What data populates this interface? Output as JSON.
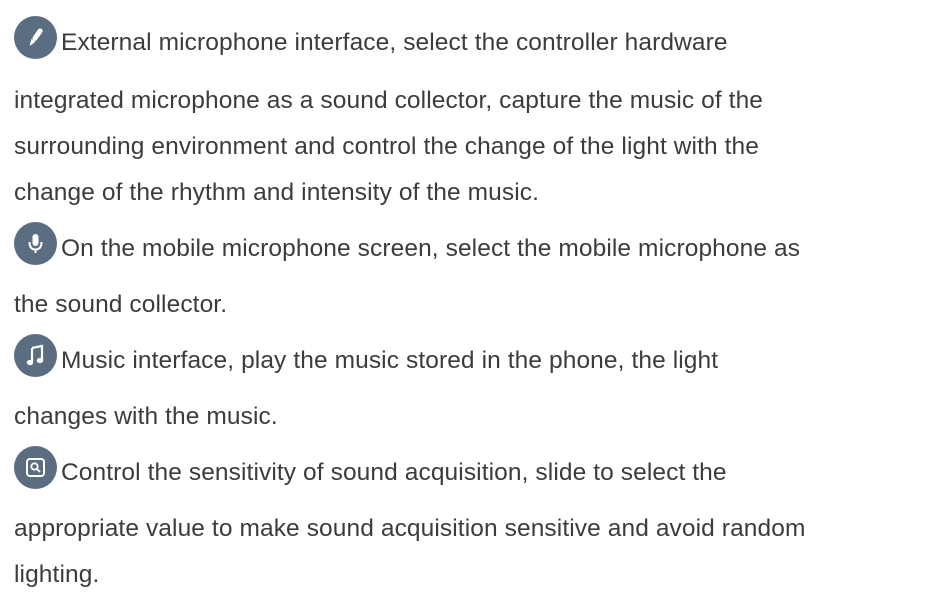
{
  "items": [
    {
      "icon": "microphone-pen-icon",
      "lines": [
        "External microphone interface, select the controller hardware",
        "integrated microphone as a sound collector, capture the music of the",
        "surrounding environment and control the change of the light with the",
        "change of the rhythm and intensity of the music."
      ]
    },
    {
      "icon": "mobile-microphone-icon",
      "lines": [
        "On the mobile microphone screen, select the mobile microphone as",
        "the sound collector."
      ]
    },
    {
      "icon": "music-note-icon",
      "lines": [
        "Music interface, play the music stored in the phone, the light",
        "changes with the music."
      ]
    },
    {
      "icon": "sensitivity-icon",
      "lines": [
        "Control the sensitivity of sound acquisition, slide to select the",
        "appropriate value to make sound acquisition sensitive and avoid random",
        "lighting."
      ]
    }
  ]
}
